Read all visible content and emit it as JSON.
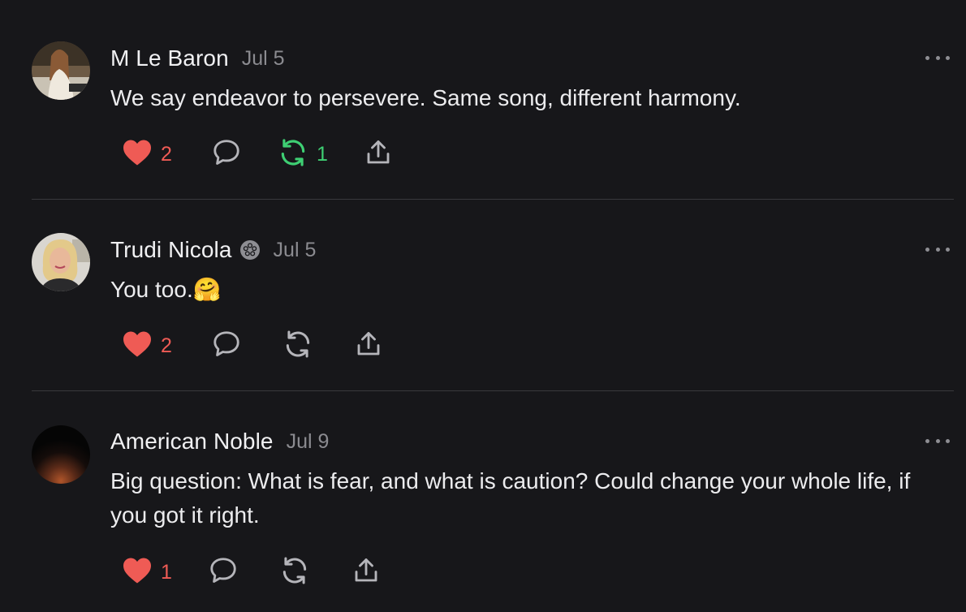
{
  "comments": [
    {
      "author": "M Le Baron",
      "date": "Jul 5",
      "verified": false,
      "text": "We say endeavor to persevere. Same song, different harmony.",
      "likes": "2",
      "restacks": "1",
      "liked": true,
      "restacked": true
    },
    {
      "author": "Trudi Nicola",
      "date": "Jul 5",
      "verified": true,
      "text": "You too.🤗",
      "likes": "2",
      "restacks": "",
      "liked": true,
      "restacked": false
    },
    {
      "author": "American Noble",
      "date": "Jul 9",
      "verified": false,
      "text": "Big question: What is fear, and what is caution? Could change your whole life, if you got it right.",
      "likes": "1",
      "restacks": "",
      "liked": true,
      "restacked": false
    }
  ],
  "icons": {
    "like": "heart-icon",
    "reply": "speech-bubble-icon",
    "restack": "restack-arrows-icon",
    "share": "share-upload-icon",
    "more": "ellipsis-icon",
    "verified": "flower-badge-icon"
  },
  "colors": {
    "background": "#17171a",
    "like": "#ef5b55",
    "restack_active": "#3ecf73",
    "muted": "#8b8b90"
  }
}
